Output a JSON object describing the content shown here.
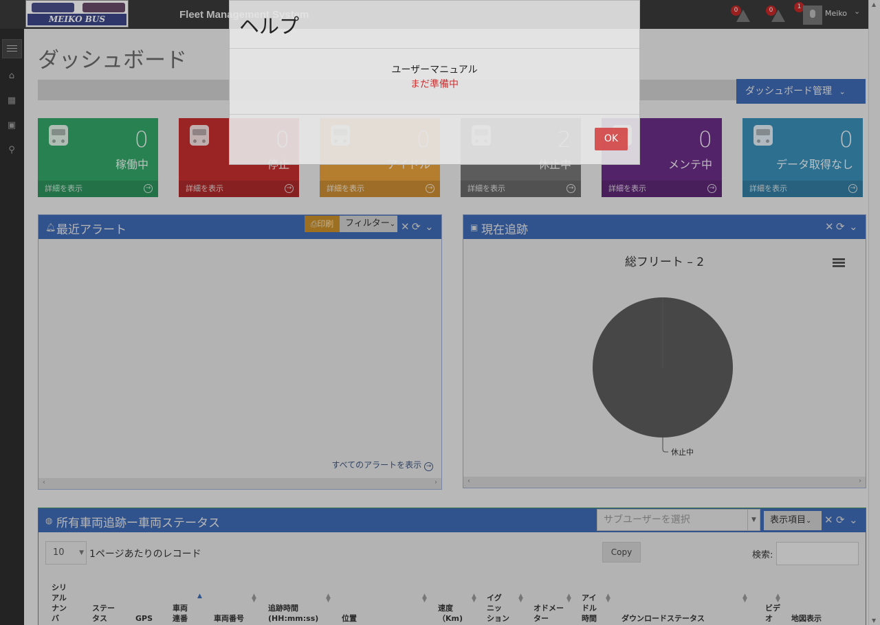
{
  "header": {
    "logo_text": "MEIKO BUS",
    "app_title": "Fleet Management System",
    "notifications": [
      {
        "count": "0"
      },
      {
        "count": "0"
      },
      {
        "count": "1"
      }
    ],
    "user_name": "Meiko"
  },
  "page": {
    "title": "ダッシュボード",
    "dashboard_manage_label": "ダッシュボード管理"
  },
  "tiles": [
    {
      "count": "0",
      "label": "稼働中",
      "link": "詳細を表示",
      "color": "#33a668"
    },
    {
      "count": "0",
      "label": "停止",
      "link": "詳細を表示",
      "color": "#c62f2f"
    },
    {
      "count": "0",
      "label": "アイドル",
      "link": "詳細を表示",
      "color": "#e8a23c"
    },
    {
      "count": "2",
      "label": "休止中",
      "link": "詳細を表示",
      "color": "#777777"
    },
    {
      "count": "0",
      "label": "メンテ中",
      "link": "詳細を表示",
      "color": "#6a2e86"
    },
    {
      "count": "0",
      "label": "データ取得なし",
      "link": "詳細を表示",
      "color": "#3a8fb8"
    }
  ],
  "alerts_panel": {
    "title": "最近アラート",
    "print_label": "印刷",
    "filter_label": "フィルター",
    "view_all_label": "すべてのアラートを表示"
  },
  "tracking_panel": {
    "title": "現在追跡"
  },
  "chart_data": {
    "type": "pie",
    "title": "総フリート – 2",
    "slices": [
      {
        "label": "休止中",
        "value": 2,
        "color": "#5b5b5b"
      }
    ]
  },
  "fleet_panel": {
    "title": "所有車両追跡ー車両ステータス",
    "sub_user_placeholder": "サブユーザーを選択",
    "columns_button": "表示項目",
    "page_length": "10",
    "page_length_label": "1ページあたりのレコード",
    "copy_label": "Copy",
    "search_label": "検索:",
    "columns": [
      "シリ\nアル\nナン\nバ",
      "ステー\nタス",
      "GPS",
      "車両\n連番",
      "車両番号",
      "追跡時間\n(HH:mm:ss)",
      "位置",
      "速度\n（Km)",
      "イグ\nニッ\nション",
      "オドメー\nター",
      "アイ\nドル\n時間",
      "ダウンロードステータス",
      "ビデ\nオ",
      "地図表示"
    ]
  },
  "modal": {
    "title": "ヘルプ",
    "body": "ユーザーマニュアル",
    "status": "まだ準備中",
    "ok_label": "OK"
  }
}
